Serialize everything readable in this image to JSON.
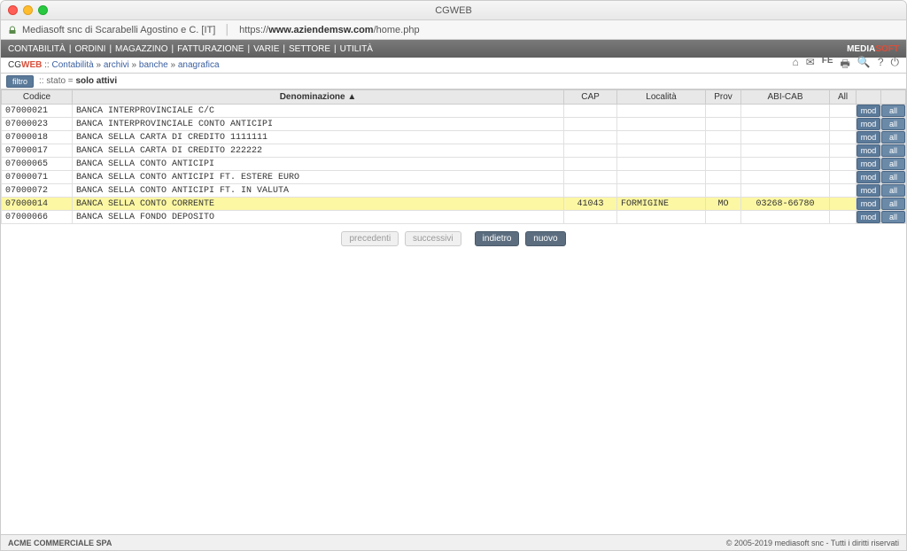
{
  "window": {
    "title": "CGWEB"
  },
  "urlbar": {
    "cert": "Mediasoft snc di Scarabelli Agostino e C. [IT]",
    "url_prefix": "https://",
    "url_host": "www.aziendemsw.com",
    "url_path": "/home.php"
  },
  "menubar": {
    "items": [
      "CONTABILITÀ",
      "ORDINI",
      "MAGAZZINO",
      "FATTURAZIONE",
      "VARIE",
      "SETTORE",
      "UTILITÀ"
    ],
    "brand_left": "MEDIA",
    "brand_right": "SOFT"
  },
  "breadcrumb": {
    "prefix_cg": "CG",
    "prefix_web": "WEB",
    "sep": " :: ",
    "items": [
      "Contabilità",
      "archivi",
      "banche",
      "anagrafica"
    ]
  },
  "filter": {
    "button": "filtro",
    "label": ":: stato = ",
    "value": "solo attivi"
  },
  "table": {
    "headers": {
      "codice": "Codice",
      "denominazione": "Denominazione ▲",
      "cap": "CAP",
      "localita": "Località",
      "prov": "Prov",
      "abicab": "ABI-CAB",
      "all": "All"
    },
    "row_buttons": {
      "mod": "mod",
      "all": "all"
    },
    "rows": [
      {
        "codice": "07000021",
        "denom": "BANCA INTERPROVINCIALE C/C",
        "cap": "",
        "loc": "",
        "prov": "",
        "abi": "",
        "highlight": false
      },
      {
        "codice": "07000023",
        "denom": "BANCA INTERPROVINCIALE CONTO ANTICIPI",
        "cap": "",
        "loc": "",
        "prov": "",
        "abi": "",
        "highlight": false
      },
      {
        "codice": "07000018",
        "denom": "BANCA SELLA CARTA DI CREDITO 1111111",
        "cap": "",
        "loc": "",
        "prov": "",
        "abi": "",
        "highlight": false
      },
      {
        "codice": "07000017",
        "denom": "BANCA SELLA CARTA DI CREDITO 222222",
        "cap": "",
        "loc": "",
        "prov": "",
        "abi": "",
        "highlight": false
      },
      {
        "codice": "07000065",
        "denom": "BANCA SELLA CONTO ANTICIPI",
        "cap": "",
        "loc": "",
        "prov": "",
        "abi": "",
        "highlight": false
      },
      {
        "codice": "07000071",
        "denom": "BANCA SELLA CONTO ANTICIPI FT. ESTERE EURO",
        "cap": "",
        "loc": "",
        "prov": "",
        "abi": "",
        "highlight": false
      },
      {
        "codice": "07000072",
        "denom": "BANCA SELLA CONTO ANTICIPI FT. IN VALUTA",
        "cap": "",
        "loc": "",
        "prov": "",
        "abi": "",
        "highlight": false
      },
      {
        "codice": "07000014",
        "denom": "BANCA SELLA CONTO CORRENTE",
        "cap": "41043",
        "loc": "FORMIGINE",
        "prov": "MO",
        "abi": "03268-66780",
        "highlight": true
      },
      {
        "codice": "07000066",
        "denom": "BANCA SELLA FONDO DEPOSITO",
        "cap": "",
        "loc": "",
        "prov": "",
        "abi": "",
        "highlight": false
      }
    ]
  },
  "pager": {
    "prev": "precedenti",
    "next": "successivi",
    "back": "indietro",
    "new": "nuovo"
  },
  "footer": {
    "company": "ACME COMMERCIALE SPA",
    "copyright": "© 2005-2019 mediasoft snc - Tutti i diritti riservati"
  }
}
